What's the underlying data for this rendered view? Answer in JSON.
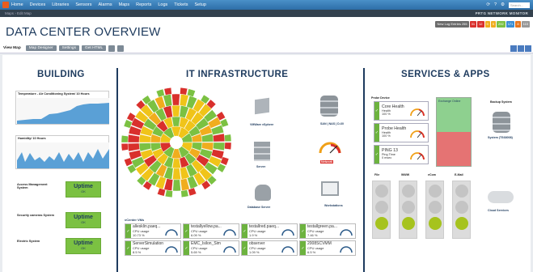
{
  "topbar": {
    "nav": [
      "Home",
      "Devices",
      "Libraries",
      "Sensors",
      "Alarms",
      "Maps",
      "Reports",
      "Logs",
      "Tickets",
      "Setup"
    ],
    "search_placeholder": "Search..."
  },
  "subbar": {
    "breadcrumb": "Maps  ›  Edit Map",
    "brand": "PRTG NETWORK MONITOR"
  },
  "page": {
    "title": "DATA CENTER OVERVIEW"
  },
  "badges": [
    {
      "text": "New Log Entries  255",
      "color": "#6b6b6b"
    },
    {
      "text": "31",
      "color": "#d9302c"
    },
    {
      "text": "12",
      "color": "#d9302c"
    },
    {
      "text": "9",
      "color": "#f0ad1e"
    },
    {
      "text": "5",
      "color": "#f0ad1e"
    },
    {
      "text": "292",
      "color": "#7bc142"
    },
    {
      "text": "171",
      "color": "#3b8ed4"
    },
    {
      "text": "8",
      "color": "#e7761e"
    },
    {
      "text": "110",
      "color": "#999999"
    }
  ],
  "toolbar": {
    "view_map": "View Map",
    "map_designer": "Map Designer",
    "settings": "Settings",
    "get_html": "Get HTML"
  },
  "sections": {
    "building": "BUILDING",
    "it": "IT INFRASTRUCTURE",
    "services": "SERVICES & APPS"
  },
  "building": {
    "chart1": "Temperature - Air Conditioning System/ 10 Hours",
    "chart2": "Humidity/ 10 Hours",
    "systems": [
      {
        "label": "Access Management System",
        "status": "Uptime",
        "sub": "OK"
      },
      {
        "label": "Security cameras System",
        "status": "Uptime",
        "sub": "OK"
      },
      {
        "label": "Electric System",
        "status": "Uptime",
        "sub": "OK"
      }
    ]
  },
  "it": {
    "devices": [
      "VMWare vSphere",
      "SAN | NAS | D-60",
      "Server",
      "Network",
      "Database Server",
      "Workstations"
    ],
    "vcenter": "vCenter VMs",
    "vms": [
      {
        "name": "allesklin.paeq...",
        "metric": "CPU usage",
        "value": "10.73 %"
      },
      {
        "name": "testallyellow.pa...",
        "metric": "CPU usage",
        "value": "6.09 %"
      },
      {
        "name": "testallred.paeq...",
        "metric": "CPU usage",
        "value": "1.9 %"
      },
      {
        "name": "testallgreen.pa...",
        "metric": "CPU usage",
        "value": "7.46 %"
      },
      {
        "name": "ServerSimulation",
        "metric": "CPU usage",
        "value": "8.5 %"
      },
      {
        "name": "EMC_Isilon_Sim",
        "metric": "CPU usage",
        "value": "5.69 %"
      },
      {
        "name": "observer",
        "metric": "CPU usage",
        "value": "1.09 %"
      },
      {
        "name": "2008SCVMM",
        "metric": "CPU usage",
        "value": "6.5 %"
      }
    ]
  },
  "services": {
    "probe_label": "Probe Device",
    "probes": [
      {
        "name": "Core Health",
        "metric": "Health",
        "value": "100 %"
      },
      {
        "name": "Probe Health",
        "metric": "Health",
        "value": "100 %"
      },
      {
        "name": "PING 13",
        "metric": "Ping Time",
        "value": "0 msec"
      }
    ],
    "exchange": "Exchange Online",
    "backup": "Backup System",
    "backup_dev": "System (TS68008)",
    "apps": [
      "File",
      "WWW",
      "eCom",
      "E-Mail"
    ],
    "cloud": "Cloud Services"
  }
}
